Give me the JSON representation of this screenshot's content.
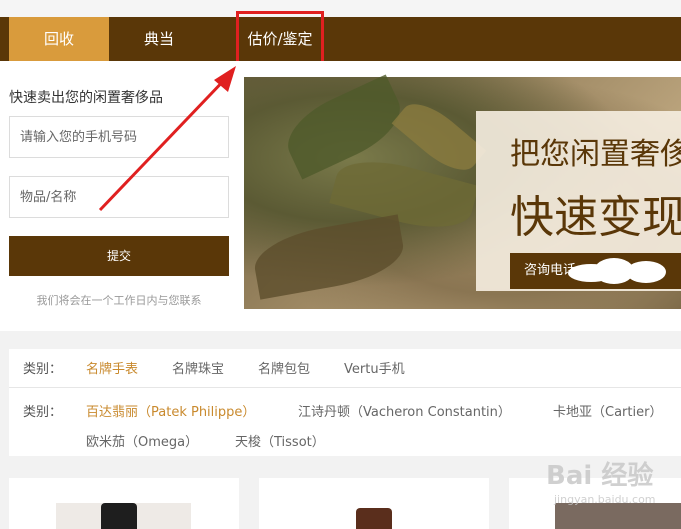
{
  "nav": {
    "tabs": [
      {
        "label": "回收"
      },
      {
        "label": "典当"
      },
      {
        "label": "估价/鉴定"
      }
    ]
  },
  "sell_form": {
    "title": "快速卖出您的闲置奢侈品",
    "phone_placeholder": "请输入您的手机号码",
    "item_placeholder": "物品/名称",
    "submit_label": "提交",
    "note": "我们将会在一个工作日内与您联系"
  },
  "banner": {
    "line1": "把您闲置奢侈",
    "line2": "快速变现",
    "bar_text": "咨询电话："
  },
  "filter": {
    "category_label": "类别：",
    "categories": [
      "名牌手表",
      "名牌珠宝",
      "名牌包包",
      "Vertu手机"
    ],
    "brand_label": "类别：",
    "brands_row1": [
      "百达翡丽（Patek Philippe）",
      "江诗丹顿（Vacheron Constantin）",
      "卡地亚（Cartier）"
    ],
    "brands_row2": [
      "欧米茄（Omega）",
      "天梭（Tissot）"
    ]
  },
  "watermark": {
    "text": "Bai 经验",
    "sub": "jingyan.baidu.com"
  },
  "colors": {
    "brand_brown": "#5a3708",
    "accent_gold": "#d99b3c",
    "active_link": "#c98a2e",
    "highlight_red": "#e02020"
  }
}
